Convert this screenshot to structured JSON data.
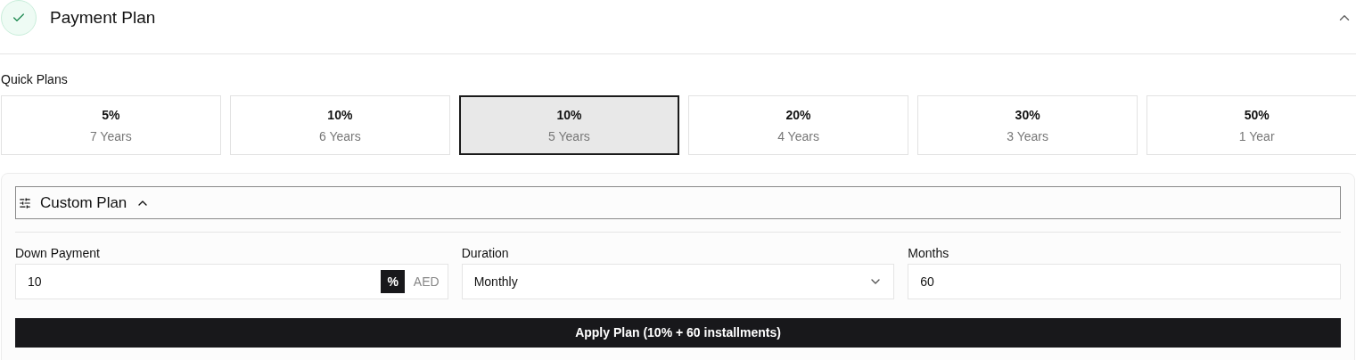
{
  "section": {
    "title": "Payment Plan",
    "completed": true,
    "expanded": true
  },
  "quick_plans": {
    "label": "Quick Plans",
    "plans": [
      {
        "percent": "5%",
        "years": "7 Years",
        "selected": false
      },
      {
        "percent": "10%",
        "years": "6 Years",
        "selected": false
      },
      {
        "percent": "10%",
        "years": "5 Years",
        "selected": true
      },
      {
        "percent": "20%",
        "years": "4 Years",
        "selected": false
      },
      {
        "percent": "30%",
        "years": "3 Years",
        "selected": false
      },
      {
        "percent": "50%",
        "years": "1 Year",
        "selected": false
      }
    ]
  },
  "custom_plan": {
    "title": "Custom Plan",
    "expanded": true,
    "down_payment": {
      "label": "Down Payment",
      "value": "10",
      "units": [
        {
          "label": "%",
          "selected": true
        },
        {
          "label": "AED",
          "selected": false
        }
      ]
    },
    "duration": {
      "label": "Duration",
      "value": "Monthly"
    },
    "months": {
      "label": "Months",
      "value": "60"
    },
    "apply_button": "Apply Plan (10% + 60 installments)"
  }
}
